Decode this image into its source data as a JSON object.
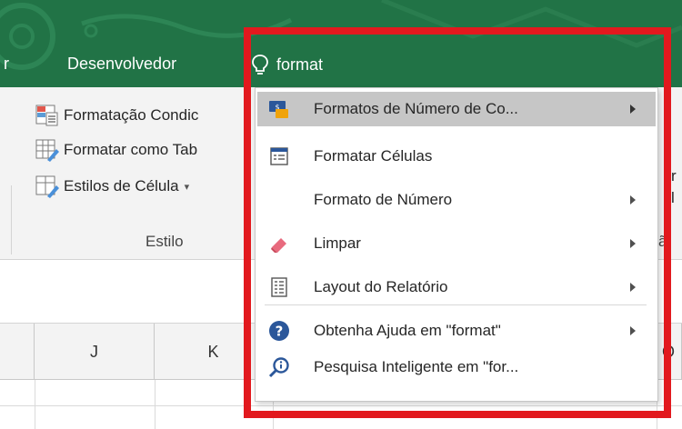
{
  "tabs": {
    "partial_left": "r",
    "developer": "Desenvolvedor"
  },
  "search": {
    "query": "format",
    "icon": "lightbulb-icon"
  },
  "ribbon": {
    "styles_group": {
      "conditional_formatting": "Formatação Condic",
      "format_as_table": "Formatar como Tab",
      "cell_styles": "Estilos de Célula",
      "cell_styles_caret": "▾",
      "label": "Estilo"
    },
    "right_fragments": {
      "r": "r",
      "l": "l",
      "ac": "ã"
    }
  },
  "columns": {
    "j": "J",
    "k": "K",
    "o": "O"
  },
  "dropdown": {
    "items": [
      {
        "label": "Formatos de Número de Co...",
        "icon": "number-format-icon",
        "has_submenu": true,
        "highlighted": true
      },
      {
        "label": "Formatar Células",
        "icon": "format-cells-icon",
        "has_submenu": false,
        "highlighted": false
      },
      {
        "label": "Formato de Número",
        "icon": "",
        "has_submenu": true,
        "highlighted": false
      },
      {
        "label": "Limpar",
        "icon": "eraser-icon",
        "has_submenu": true,
        "highlighted": false
      },
      {
        "label": "Layout do Relatório",
        "icon": "report-layout-icon",
        "has_submenu": true,
        "highlighted": false
      },
      {
        "label": "Obtenha Ajuda em \"format\"",
        "icon": "help-icon",
        "has_submenu": true,
        "highlighted": false
      },
      {
        "label": "Pesquisa Inteligente em \"for...",
        "icon": "smart-lookup-icon",
        "has_submenu": false,
        "highlighted": false
      }
    ]
  },
  "colors": {
    "excel_green": "#217346",
    "highlight": "#c6c6c6",
    "annotation_red": "#e2191e",
    "help_blue": "#2b579a",
    "eraser_pink": "#e86a7e"
  }
}
